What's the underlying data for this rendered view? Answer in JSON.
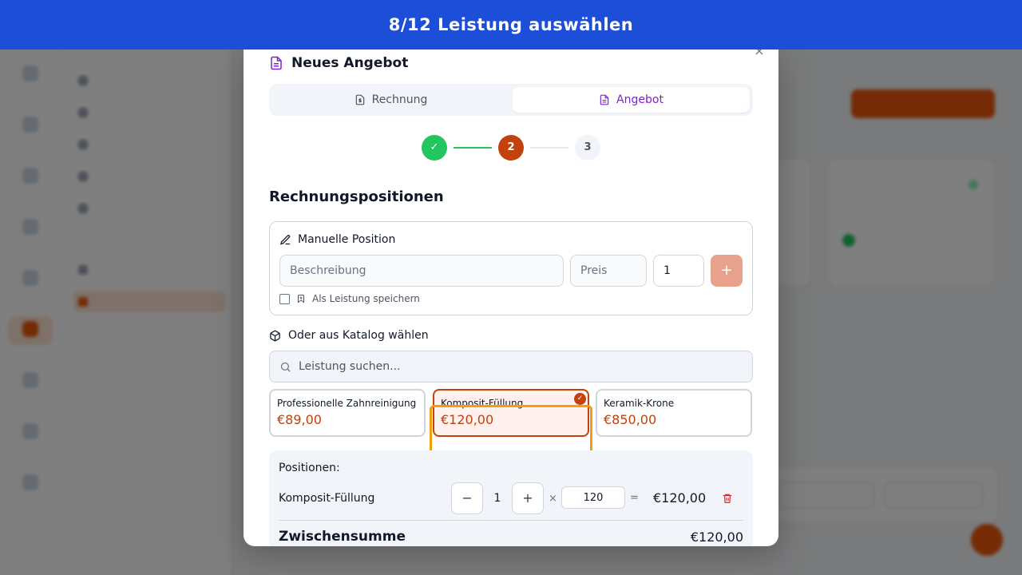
{
  "banner": {
    "title": "8/12 Leistung auswählen"
  },
  "modal": {
    "close_symbol": "×",
    "title": "Neues Angebot",
    "tabs": [
      {
        "label": "Rechnung",
        "icon": "dollar-file-icon",
        "active": false
      },
      {
        "label": "Angebot",
        "icon": "file-icon",
        "active": true
      }
    ],
    "steps": [
      {
        "label": "✓",
        "state": "done"
      },
      {
        "label": "2",
        "state": "current"
      },
      {
        "label": "3",
        "state": "upcoming"
      }
    ],
    "section_title": "Rechnungspositionen",
    "manual": {
      "heading": "Manuelle Position",
      "description_placeholder": "Beschreibung",
      "price_placeholder": "Preis",
      "quantity_value": "1",
      "add_label": "+",
      "save_as_service_label": "Als Leistung speichern",
      "save_as_service_checked": false
    },
    "catalog": {
      "heading": "Oder aus Katalog wählen",
      "search_placeholder": "Leistung suchen...",
      "items": [
        {
          "name": "Professionelle Zahnreinigung",
          "price": "€89,00",
          "selected": false
        },
        {
          "name": "Komposit-Füllung",
          "price": "€120,00",
          "selected": true
        },
        {
          "name": "Keramik-Krone",
          "price": "€850,00",
          "selected": false
        }
      ]
    },
    "positions": {
      "label": "Positionen:",
      "rows": [
        {
          "name": "Komposit-Füllung",
          "quantity": "1",
          "unit_price": "120",
          "total": "€120,00"
        }
      ],
      "minus_label": "−",
      "plus_label": "+",
      "times_symbol": "×",
      "equals_symbol": "=",
      "subtotal_label": "Zwischensumme",
      "subtotal_value": "€120,00"
    }
  },
  "colors": {
    "banner": "#1d4ed8",
    "accent": "#c2410c",
    "purple": "#7e22ce",
    "success": "#22c55e",
    "highlight": "#f59e0b"
  }
}
